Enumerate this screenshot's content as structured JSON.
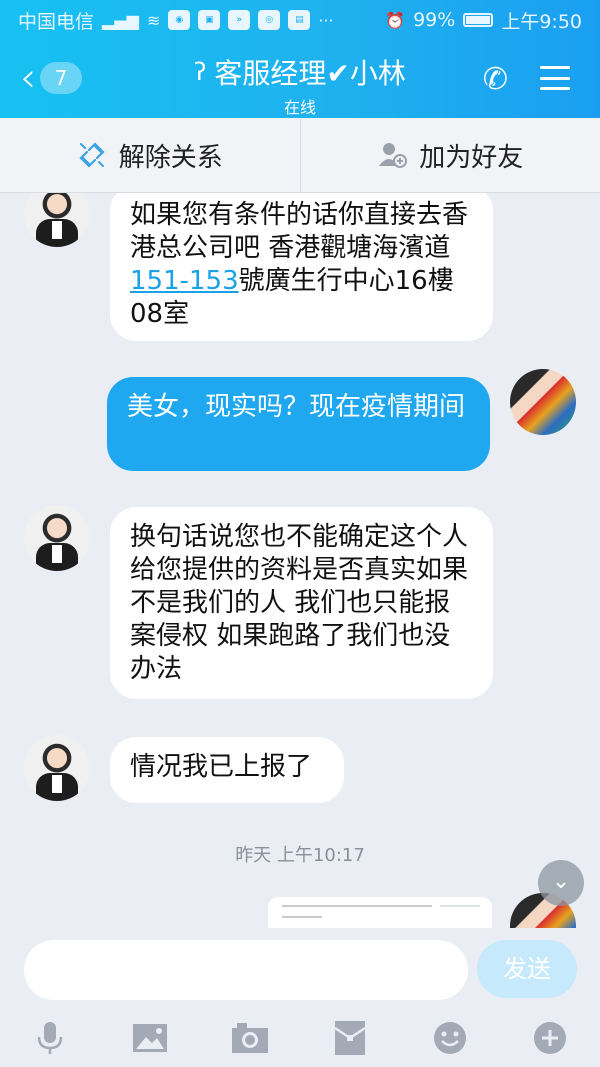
{
  "status_bar": {
    "carrier": "中国电信",
    "network": "4G",
    "battery": "99%",
    "time": "上午9:50"
  },
  "header": {
    "unread_count": "7",
    "title": "客服经理✔小林",
    "subtitle": "在线"
  },
  "actions": {
    "unlink": "解除关系",
    "add_friend": "加为好友"
  },
  "messages": [
    {
      "side": "in",
      "text_before": "如果您有条件的话你直接去香港总公司吧 香港觀塘海濱道",
      "link": "151-153",
      "text_after": "號廣生行中心16樓08室"
    },
    {
      "side": "out",
      "text": "美女，现实吗？现在疫情期间"
    },
    {
      "side": "in",
      "text": "换句话说您也不能确定这个人给您提供的资料是否真实如果不是我们的人 我们也只能报案侵权 如果跑路了我们也没办法"
    },
    {
      "side": "in",
      "text": "情况我已上报了"
    }
  ],
  "timestamp": "昨天 上午10:17",
  "composer": {
    "placeholder": "",
    "send_label": "发送"
  },
  "toolbar_icons": [
    "mic-icon",
    "image-icon",
    "camera-icon",
    "red-packet-icon",
    "emoji-icon",
    "plus-icon"
  ],
  "colors": {
    "header_start": "#17c1f2",
    "header_end": "#1a9ff0",
    "outgoing_bubble": "#1fa8f0",
    "link": "#1aa1e8",
    "send_button": "#c6e9fc"
  }
}
